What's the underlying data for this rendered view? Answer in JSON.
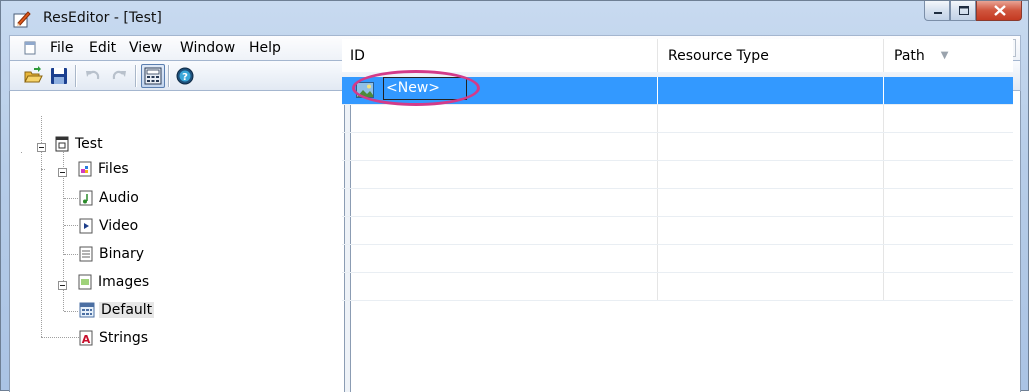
{
  "window": {
    "title": "ResEditor - [Test]"
  },
  "menu": {
    "items": [
      "File",
      "Edit",
      "View",
      "Window",
      "Help"
    ]
  },
  "toolbar": {
    "buttons": [
      {
        "icon": "open-folder-icon"
      },
      {
        "icon": "save-icon"
      },
      {
        "icon": "undo-icon"
      },
      {
        "icon": "redo-icon"
      },
      {
        "icon": "calculator-icon",
        "active": true
      },
      {
        "icon": "help-icon"
      }
    ]
  },
  "tree": {
    "root": "Test",
    "files": "Files",
    "audio": "Audio",
    "video": "Video",
    "binary": "Binary",
    "images": "Images",
    "default": "Default",
    "strings": "Strings"
  },
  "list": {
    "columns": [
      "ID",
      "Resource Type",
      "Path"
    ],
    "rows": [
      {
        "id": "<New>",
        "type": "",
        "path": "",
        "selected": true,
        "editing": true
      }
    ]
  },
  "colors": {
    "selection": "#3399ff",
    "highlight_ring": "#d33b8a",
    "close_button": "#c43a22"
  }
}
